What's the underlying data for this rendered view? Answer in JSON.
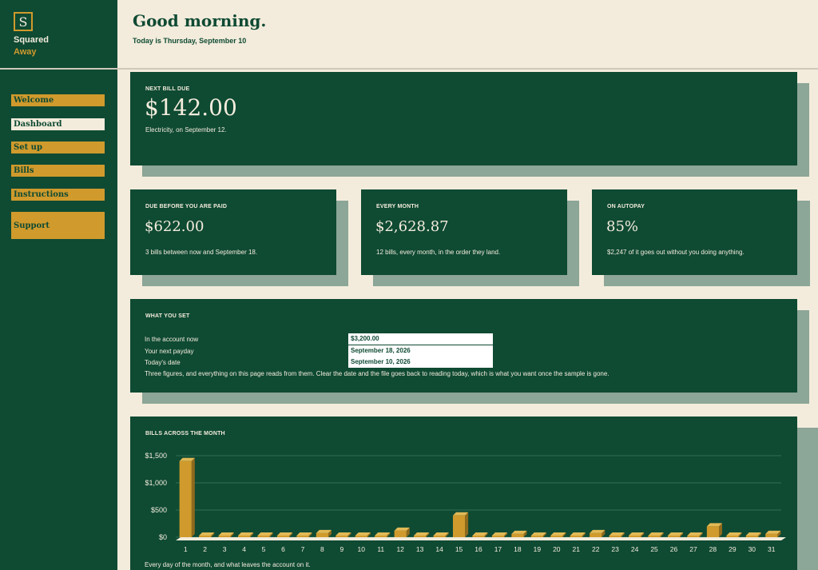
{
  "brand": {
    "logo_letter": "S",
    "name_line1": "Squared",
    "name_line2": "Away"
  },
  "nav": {
    "items": [
      {
        "label": "Welcome",
        "active": false
      },
      {
        "label": "Dashboard",
        "active": true
      },
      {
        "label": "Set up",
        "active": false
      },
      {
        "label": "Bills",
        "active": false
      },
      {
        "label": "Instructions",
        "active": false
      },
      {
        "label": "Support",
        "active": false
      }
    ]
  },
  "header": {
    "greeting": "Good morning.",
    "date_line": "Today is Thursday, September 10"
  },
  "next_bill": {
    "eyebrow": "NEXT BILL DUE",
    "amount": "$142.00",
    "note": "Electricity, on September 12."
  },
  "stats": [
    {
      "eyebrow": "DUE BEFORE YOU ARE PAID",
      "value": "$622.00",
      "note": "3 bills between now and September 18."
    },
    {
      "eyebrow": "EVERY MONTH",
      "value": "$2,628.87",
      "note": "12 bills, every month, in the order they land."
    },
    {
      "eyebrow": "ON AUTOPAY",
      "value": "85%",
      "note": "$2,247 of it goes out without you doing anything."
    }
  ],
  "what_you_set": {
    "eyebrow": "WHAT YOU SET",
    "rows": [
      {
        "label": "In the account now",
        "value": "$3,200.00"
      },
      {
        "label": "Your next payday",
        "value": "September 18, 2026"
      },
      {
        "label": "Today's date",
        "value": "September 10, 2026"
      }
    ],
    "note": "Three figures, and everything on this page reads from them. Clear the date and the file goes back to reading today, which is what you want once the sample is gone."
  },
  "chart_section": {
    "eyebrow": "BILLS ACROSS THE MONTH",
    "caption": "Every day of the month, and what leaves the account on it."
  },
  "colors": {
    "forest": "#0f4a33",
    "gold": "#d09a2c",
    "cream": "#f3ecdc",
    "shadow": "#8ca697"
  },
  "chart_data": {
    "type": "bar",
    "title": "BILLS ACROSS THE MONTH",
    "categories": [
      "1",
      "2",
      "3",
      "4",
      "5",
      "6",
      "7",
      "8",
      "9",
      "10",
      "11",
      "12",
      "13",
      "14",
      "15",
      "16",
      "17",
      "18",
      "19",
      "20",
      "21",
      "22",
      "23",
      "24",
      "25",
      "26",
      "27",
      "28",
      "29",
      "30",
      "31"
    ],
    "values": [
      1400,
      0,
      0,
      0,
      5,
      0,
      0,
      75,
      10,
      0,
      0,
      120,
      0,
      0,
      400,
      0,
      0,
      60,
      0,
      20,
      0,
      75,
      0,
      0,
      0,
      0,
      0,
      200,
      0,
      0,
      60
    ],
    "ylim": [
      0,
      1500
    ],
    "yticks": [
      0,
      500,
      1000,
      1500
    ],
    "ytick_labels": [
      "$0",
      "$500",
      "$1,000",
      "$1,500"
    ],
    "grid": true,
    "xlabel": "",
    "ylabel": ""
  }
}
